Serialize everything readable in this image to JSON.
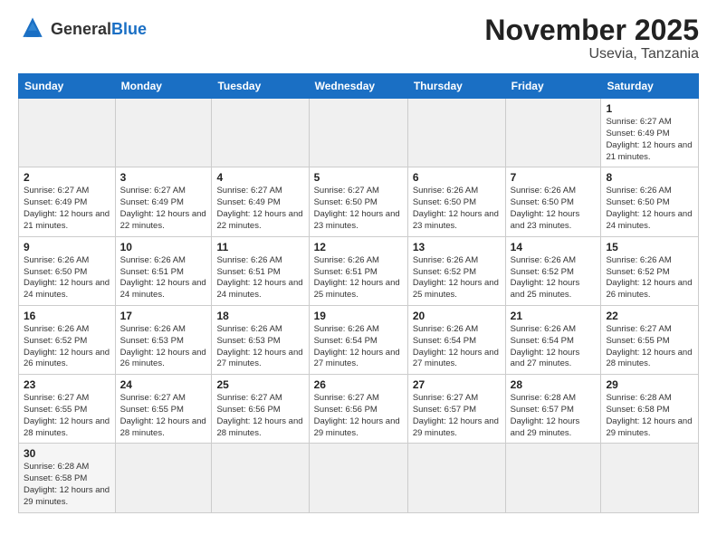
{
  "logo": {
    "general": "General",
    "blue": "Blue"
  },
  "title": "November 2025",
  "subtitle": "Usevia, Tanzania",
  "days_of_week": [
    "Sunday",
    "Monday",
    "Tuesday",
    "Wednesday",
    "Thursday",
    "Friday",
    "Saturday"
  ],
  "weeks": [
    [
      {
        "day": "",
        "info": "",
        "empty": true
      },
      {
        "day": "",
        "info": "",
        "empty": true
      },
      {
        "day": "",
        "info": "",
        "empty": true
      },
      {
        "day": "",
        "info": "",
        "empty": true
      },
      {
        "day": "",
        "info": "",
        "empty": true
      },
      {
        "day": "",
        "info": "",
        "empty": true
      },
      {
        "day": "1",
        "info": "Sunrise: 6:27 AM\nSunset: 6:49 PM\nDaylight: 12 hours\nand 21 minutes."
      }
    ],
    [
      {
        "day": "2",
        "info": "Sunrise: 6:27 AM\nSunset: 6:49 PM\nDaylight: 12 hours\nand 21 minutes."
      },
      {
        "day": "3",
        "info": "Sunrise: 6:27 AM\nSunset: 6:49 PM\nDaylight: 12 hours\nand 22 minutes."
      },
      {
        "day": "4",
        "info": "Sunrise: 6:27 AM\nSunset: 6:49 PM\nDaylight: 12 hours\nand 22 minutes."
      },
      {
        "day": "5",
        "info": "Sunrise: 6:27 AM\nSunset: 6:50 PM\nDaylight: 12 hours\nand 23 minutes."
      },
      {
        "day": "6",
        "info": "Sunrise: 6:26 AM\nSunset: 6:50 PM\nDaylight: 12 hours\nand 23 minutes."
      },
      {
        "day": "7",
        "info": "Sunrise: 6:26 AM\nSunset: 6:50 PM\nDaylight: 12 hours\nand 23 minutes."
      },
      {
        "day": "8",
        "info": "Sunrise: 6:26 AM\nSunset: 6:50 PM\nDaylight: 12 hours\nand 24 minutes."
      }
    ],
    [
      {
        "day": "9",
        "info": "Sunrise: 6:26 AM\nSunset: 6:50 PM\nDaylight: 12 hours\nand 24 minutes."
      },
      {
        "day": "10",
        "info": "Sunrise: 6:26 AM\nSunset: 6:51 PM\nDaylight: 12 hours\nand 24 minutes."
      },
      {
        "day": "11",
        "info": "Sunrise: 6:26 AM\nSunset: 6:51 PM\nDaylight: 12 hours\nand 24 minutes."
      },
      {
        "day": "12",
        "info": "Sunrise: 6:26 AM\nSunset: 6:51 PM\nDaylight: 12 hours\nand 25 minutes."
      },
      {
        "day": "13",
        "info": "Sunrise: 6:26 AM\nSunset: 6:52 PM\nDaylight: 12 hours\nand 25 minutes."
      },
      {
        "day": "14",
        "info": "Sunrise: 6:26 AM\nSunset: 6:52 PM\nDaylight: 12 hours\nand 25 minutes."
      },
      {
        "day": "15",
        "info": "Sunrise: 6:26 AM\nSunset: 6:52 PM\nDaylight: 12 hours\nand 26 minutes."
      }
    ],
    [
      {
        "day": "16",
        "info": "Sunrise: 6:26 AM\nSunset: 6:52 PM\nDaylight: 12 hours\nand 26 minutes."
      },
      {
        "day": "17",
        "info": "Sunrise: 6:26 AM\nSunset: 6:53 PM\nDaylight: 12 hours\nand 26 minutes."
      },
      {
        "day": "18",
        "info": "Sunrise: 6:26 AM\nSunset: 6:53 PM\nDaylight: 12 hours\nand 27 minutes."
      },
      {
        "day": "19",
        "info": "Sunrise: 6:26 AM\nSunset: 6:54 PM\nDaylight: 12 hours\nand 27 minutes."
      },
      {
        "day": "20",
        "info": "Sunrise: 6:26 AM\nSunset: 6:54 PM\nDaylight: 12 hours\nand 27 minutes."
      },
      {
        "day": "21",
        "info": "Sunrise: 6:26 AM\nSunset: 6:54 PM\nDaylight: 12 hours\nand 27 minutes."
      },
      {
        "day": "22",
        "info": "Sunrise: 6:27 AM\nSunset: 6:55 PM\nDaylight: 12 hours\nand 28 minutes."
      }
    ],
    [
      {
        "day": "23",
        "info": "Sunrise: 6:27 AM\nSunset: 6:55 PM\nDaylight: 12 hours\nand 28 minutes."
      },
      {
        "day": "24",
        "info": "Sunrise: 6:27 AM\nSunset: 6:55 PM\nDaylight: 12 hours\nand 28 minutes."
      },
      {
        "day": "25",
        "info": "Sunrise: 6:27 AM\nSunset: 6:56 PM\nDaylight: 12 hours\nand 28 minutes."
      },
      {
        "day": "26",
        "info": "Sunrise: 6:27 AM\nSunset: 6:56 PM\nDaylight: 12 hours\nand 29 minutes."
      },
      {
        "day": "27",
        "info": "Sunrise: 6:27 AM\nSunset: 6:57 PM\nDaylight: 12 hours\nand 29 minutes."
      },
      {
        "day": "28",
        "info": "Sunrise: 6:28 AM\nSunset: 6:57 PM\nDaylight: 12 hours\nand 29 minutes."
      },
      {
        "day": "29",
        "info": "Sunrise: 6:28 AM\nSunset: 6:58 PM\nDaylight: 12 hours\nand 29 minutes."
      }
    ],
    [
      {
        "day": "30",
        "info": "Sunrise: 6:28 AM\nSunset: 6:58 PM\nDaylight: 12 hours\nand 29 minutes."
      },
      {
        "day": "",
        "info": "",
        "empty": true
      },
      {
        "day": "",
        "info": "",
        "empty": true
      },
      {
        "day": "",
        "info": "",
        "empty": true
      },
      {
        "day": "",
        "info": "",
        "empty": true
      },
      {
        "day": "",
        "info": "",
        "empty": true
      },
      {
        "day": "",
        "info": "",
        "empty": true
      }
    ]
  ]
}
